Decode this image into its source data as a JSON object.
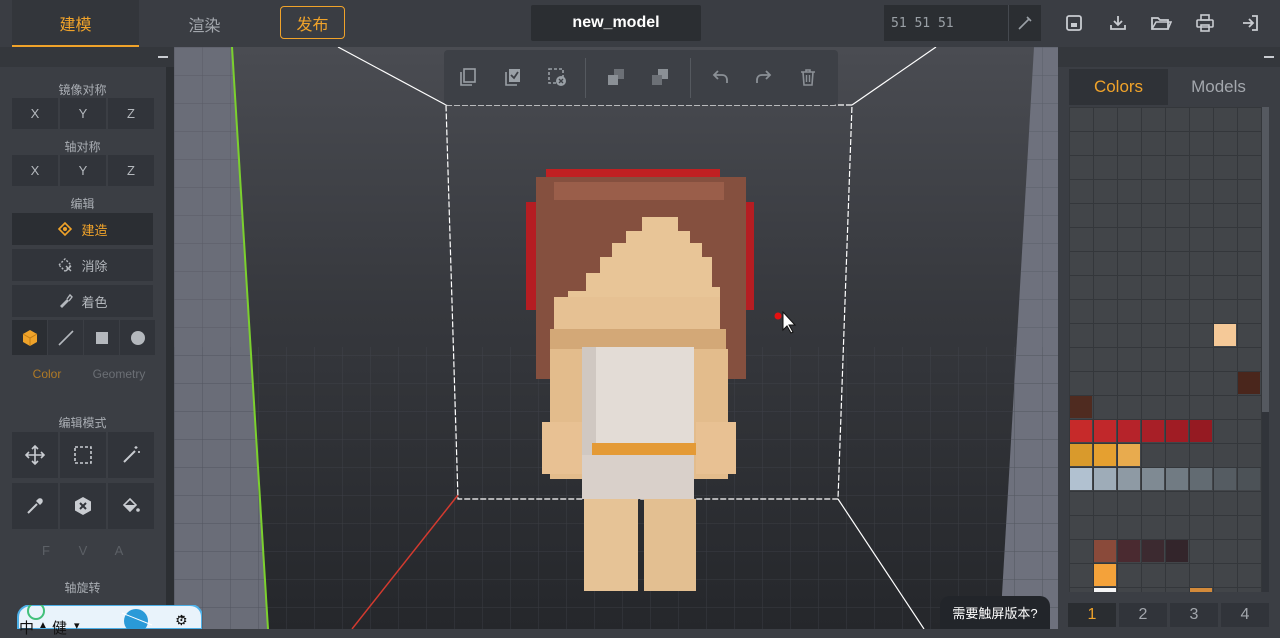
{
  "topbar": {
    "tab_build": "建模",
    "tab_render": "渲染",
    "publish": "发布",
    "model_name": "new_model",
    "color_value": "51 51 51"
  },
  "left": {
    "mirror_title": "镜像对称",
    "mirror_axes": [
      "X",
      "Y",
      "Z"
    ],
    "axis_title": "轴对称",
    "axis_axes": [
      "X",
      "Y",
      "Z"
    ],
    "edit_title": "编辑",
    "build": "建造",
    "erase": "消除",
    "paint": "着色",
    "tab_color": "Color",
    "tab_geometry": "Geometry",
    "mode_title": "编辑模式",
    "fva": [
      "F",
      "V",
      "A"
    ],
    "rotate_title": "轴旋转"
  },
  "right": {
    "tab_colors": "Colors",
    "tab_models": "Models",
    "pages": [
      "1",
      "2",
      "3",
      "4"
    ],
    "swatches": [
      {
        "c": 6,
        "r": 9,
        "color": "#f5c998"
      },
      {
        "c": 7,
        "r": 11,
        "color": "#4a261c"
      },
      {
        "c": 0,
        "r": 12,
        "color": "#4f2b20"
      },
      {
        "c": 0,
        "r": 13,
        "color": "#c62a2a"
      },
      {
        "c": 1,
        "r": 13,
        "color": "#c1282b"
      },
      {
        "c": 2,
        "r": 13,
        "color": "#b6232a"
      },
      {
        "c": 3,
        "r": 13,
        "color": "#a81f27"
      },
      {
        "c": 4,
        "r": 13,
        "color": "#a01c24"
      },
      {
        "c": 5,
        "r": 13,
        "color": "#951a22"
      },
      {
        "c": 0,
        "r": 14,
        "color": "#d99a2c"
      },
      {
        "c": 1,
        "r": 14,
        "color": "#e5a030"
      },
      {
        "c": 2,
        "r": 14,
        "color": "#e8ab4e"
      },
      {
        "c": 0,
        "r": 15,
        "color": "#b1c1d0"
      },
      {
        "c": 1,
        "r": 15,
        "color": "#9eacb8"
      },
      {
        "c": 2,
        "r": 15,
        "color": "#8e9aa4"
      },
      {
        "c": 3,
        "r": 15,
        "color": "#7f8a93"
      },
      {
        "c": 4,
        "r": 15,
        "color": "#717b83"
      },
      {
        "c": 5,
        "r": 15,
        "color": "#626b72"
      },
      {
        "c": 6,
        "r": 15,
        "color": "#555c62"
      },
      {
        "c": 7,
        "r": 15,
        "color": "#4c5257"
      },
      {
        "c": 1,
        "r": 18,
        "color": "#8a4a3a"
      },
      {
        "c": 2,
        "r": 18,
        "color": "#4a2a30"
      },
      {
        "c": 3,
        "r": 18,
        "color": "#3c2a30"
      },
      {
        "c": 4,
        "r": 18,
        "color": "#33252b"
      },
      {
        "c": 1,
        "r": 19,
        "color": "#f4a23a"
      },
      {
        "c": 1,
        "r": 20,
        "color": "#f5f5f5"
      },
      {
        "c": 5,
        "r": 20,
        "color": "#d38a3a"
      }
    ]
  },
  "tip": "需要触屏版本?",
  "ime": {
    "lang": "中",
    "mode": "健"
  }
}
